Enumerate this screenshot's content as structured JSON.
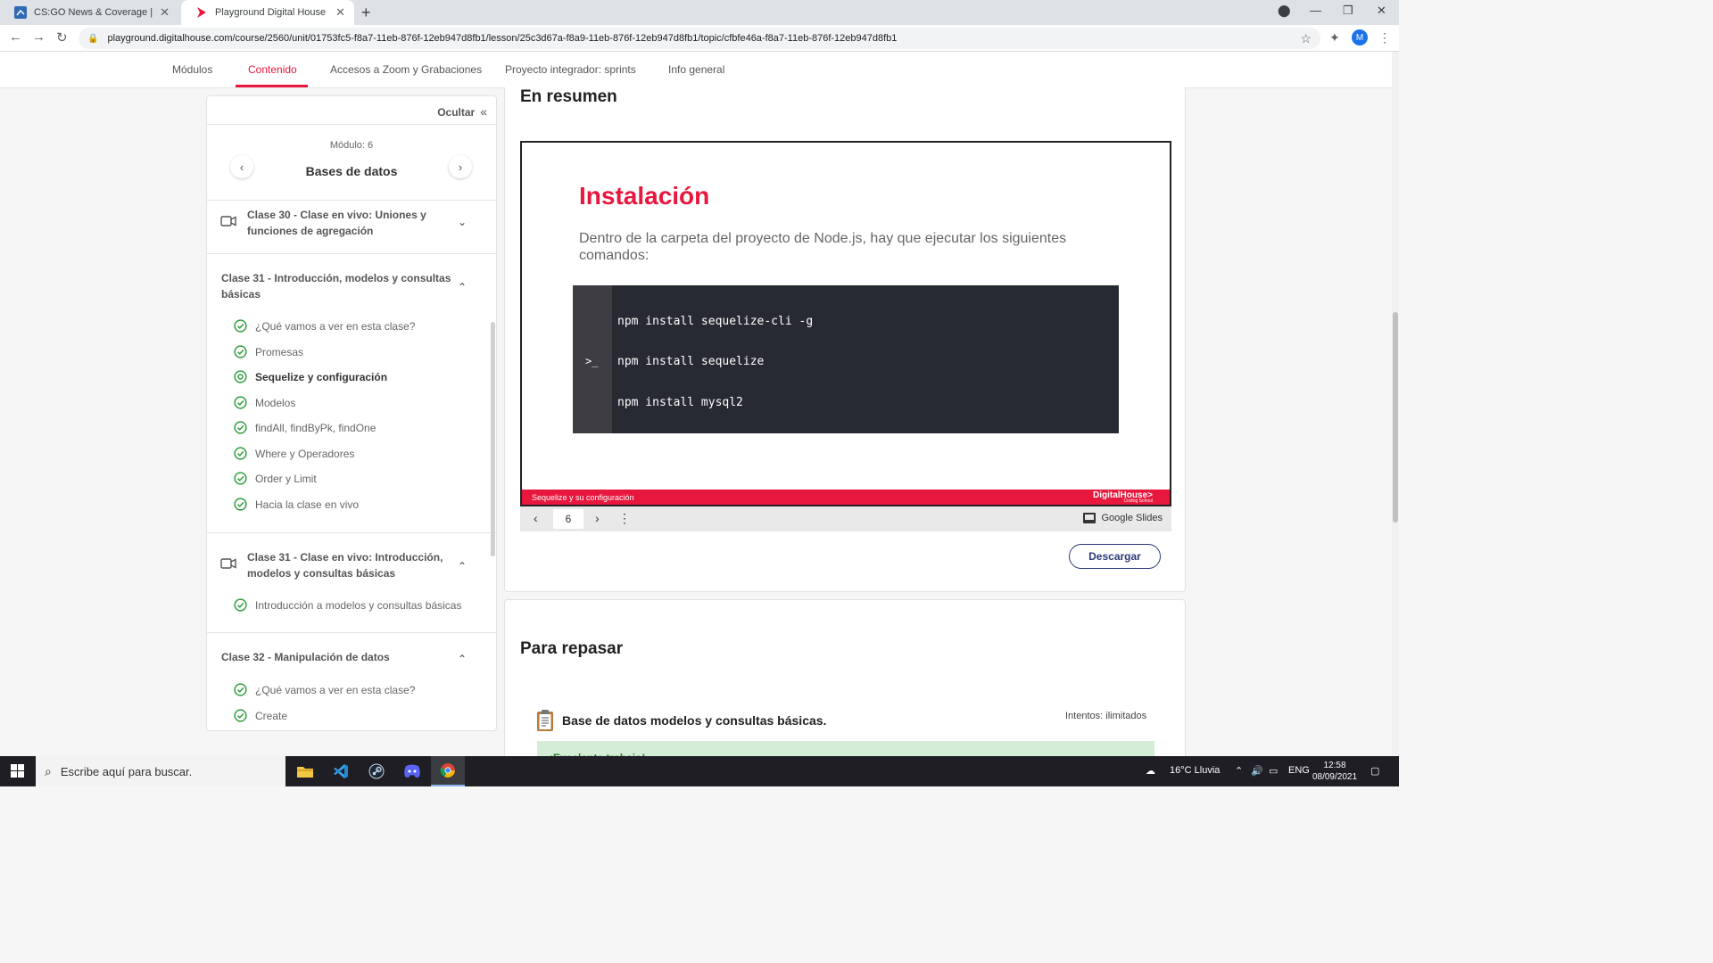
{
  "browser": {
    "tabs": [
      {
        "title": "CS:GO News & Coverage | HLTV.",
        "active": false
      },
      {
        "title": "Playground Digital House",
        "active": true
      }
    ],
    "url": "playground.digitalhouse.com/course/2560/unit/01753fc5-f8a7-11eb-876f-12eb947d8fb1/lesson/25c3d67a-f8a9-11eb-876f-12eb947d8fb1/topic/cfbfe46a-f8a7-11eb-876f-12eb947d8fb1",
    "profile_initial": "M"
  },
  "sitenav": {
    "items": [
      "Módulos",
      "Contenido",
      "Accesos a Zoom y Grabaciones",
      "Proyecto integrador: sprints",
      "Info general"
    ],
    "active_index": 1,
    "accent": "#e8173d"
  },
  "sidebar": {
    "hide_label": "Ocultar",
    "module_label": "Módulo: 6",
    "module_title": "Bases de datos",
    "sections": [
      {
        "title_l1": "Clase 30 - Clase en vivo: Uniones y",
        "title_l2": "funciones de agregación",
        "icon": "video-icon",
        "expanded": false
      },
      {
        "title_l1": "Clase 31 - Introducción, modelos y consultas",
        "title_l2": "básicas",
        "expanded": true,
        "items": [
          "¿Qué vamos a ver en esta clase?",
          "Promesas",
          "Sequelize y configuración",
          "Modelos",
          "findAll, findByPk, findOne",
          "Where y Operadores",
          "Order y Limit",
          "Hacia la clase en vivo"
        ],
        "current_index": 2
      },
      {
        "title_l1": "Clase 31 - Clase en vivo: Introducción,",
        "title_l2": "modelos y consultas básicas",
        "icon": "video-icon",
        "expanded": true,
        "items": [
          "Introducción a modelos y consultas básicas"
        ]
      },
      {
        "title_l1": "Clase 32 - Manipulación de datos",
        "expanded": true,
        "items": [
          "¿Qué vamos a ver en esta clase?",
          "Create"
        ]
      }
    ],
    "check_color": "#2e9e3e"
  },
  "main": {
    "heading": "En resumen",
    "slide": {
      "title": "Instalación",
      "text": "Dentro de la carpeta del proyecto de Node.js, hay que ejecutar los siguientes comandos:",
      "prompt": ">_",
      "commands": [
        "npm install sequelize-cli -g",
        "npm install sequelize",
        "npm install mysql2"
      ],
      "footer_text": "Sequelize y su configuración",
      "brand": "DigitalHouse>",
      "brand_sub": "Coding School"
    },
    "slides_bar": {
      "page": "6",
      "provider": "Google Slides"
    },
    "download_label": "Descargar",
    "review": {
      "heading": "Para repasar",
      "quiz_title": "Base de datos modelos y consultas básicas.",
      "attempts": "Intentos: ilimitados",
      "success_text": "¡Excelente trabajo!"
    }
  },
  "taskbar": {
    "search_placeholder": "Escribe aquí para buscar.",
    "apps": [
      "file-explorer-icon",
      "vscode-icon",
      "steam-icon",
      "discord-icon",
      "chrome-icon"
    ],
    "weather": "16°C  Lluvia",
    "language": "ENG",
    "time": "12:58",
    "date": "08/09/2021"
  }
}
